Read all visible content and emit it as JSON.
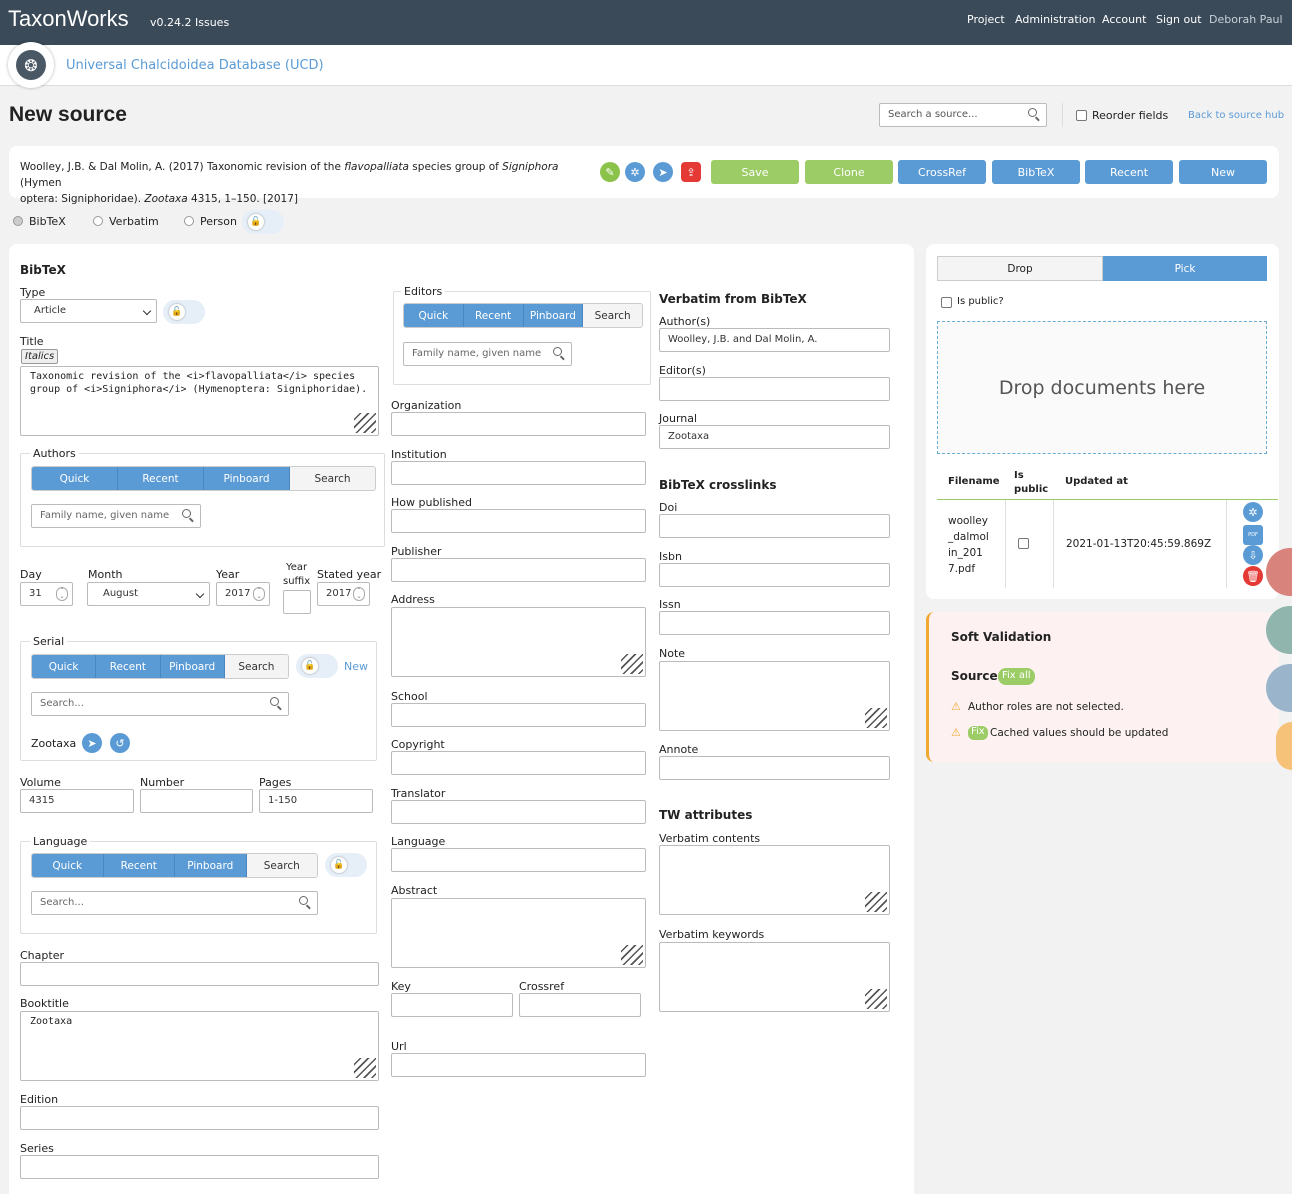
{
  "app": {
    "brand": "TaxonWorks",
    "version": "v0.24.2",
    "issues": "Issues",
    "project_name": "Universal Chalcidoidea Database (UCD)"
  },
  "nav": [
    "Project",
    "Administration",
    "Account",
    "Sign out",
    "Deborah Paul"
  ],
  "page": {
    "title": "New source",
    "search_placeholder": "Search a source...",
    "reorder_fields": "Reorder fields",
    "back_link": "Back to source hub"
  },
  "citation": {
    "part1": "Woolley, J.B. & Dal Molin, A. (2017) Taxonomic revision of the ",
    "italic1": "flavopalliata",
    "part2": " species group of ",
    "italic2": "Signiphora",
    "part3": " (Hymen",
    "line2_part1": "optera: Signiphoridae). ",
    "italic3": "Zootaxa",
    "line2_part2": " 4315, 1–150. [2017]"
  },
  "actions": [
    "Save",
    "Clone",
    "CrossRef",
    "BibTeX",
    "Recent",
    "New"
  ],
  "modes": {
    "bibtex": "BibTeX",
    "verbatim": "Verbatim",
    "person": "Person"
  },
  "bibtex": {
    "heading": "BibTeX",
    "type_label": "Type",
    "type_value": "Article",
    "title_label": "Title",
    "italics_btn": "Italics",
    "title_line1": "Taxonomic revision of the <i>flavopalliata</i> species",
    "title_line2": "group of <i>Signiphora</i> (Hymenoptera: Signiphoridae).",
    "authors_legend": "Authors",
    "tabs": [
      "Quick",
      "Recent",
      "Pinboard",
      "Search"
    ],
    "person_placeholder": "Family name, given name",
    "day_label": "Day",
    "day_value": "31",
    "month_label": "Month",
    "month_value": "August",
    "year_label": "Year",
    "year_value": "2017",
    "year_suffix_label1": "Year",
    "year_suffix_label2": "suffix",
    "stated_year_label": "Stated year",
    "stated_year_value": "2017",
    "serial_legend": "Serial",
    "serial_new": "New",
    "search_placeholder": "Search...",
    "serial_value": "Zootaxa",
    "volume_label": "Volume",
    "volume_value": "4315",
    "number_label": "Number",
    "pages_label": "Pages",
    "pages_value": "1-150",
    "language_legend": "Language",
    "chapter_label": "Chapter",
    "booktitle_label": "Booktitle",
    "booktitle_value": "Zootaxa",
    "edition_label": "Edition",
    "series_label": "Series"
  },
  "middle": {
    "editors_legend": "Editors",
    "organization": "Organization",
    "institution": "Institution",
    "how_published": "How published",
    "publisher": "Publisher",
    "address": "Address",
    "school": "School",
    "copyright": "Copyright",
    "translator": "Translator",
    "language": "Language",
    "abstract": "Abstract",
    "key": "Key",
    "crossref": "Crossref",
    "url": "Url"
  },
  "verbatim": {
    "heading": "Verbatim from BibTeX",
    "authors_label": "Author(s)",
    "authors_value": "Woolley, J.B. and Dal Molin, A.",
    "editors_label": "Editor(s)",
    "journal_label": "Journal",
    "journal_value": "Zootaxa",
    "crosslinks_heading": "BibTeX crosslinks",
    "doi": "Doi",
    "isbn": "Isbn",
    "issn": "Issn",
    "note": "Note",
    "annote": "Annote",
    "tw_heading": "TW attributes",
    "verbatim_contents": "Verbatim contents",
    "verbatim_keywords": "Verbatim keywords"
  },
  "documents": {
    "tab_drop": "Drop",
    "tab_pick": "Pick",
    "is_public": "Is public?",
    "drop_text": "Drop documents here",
    "col_filename": "Filename",
    "col_public1": "Is",
    "col_public2": "public",
    "col_updated": "Updated at",
    "file_l1": "woolley",
    "file_l2": "_dalmol",
    "file_l3": "in_201",
    "file_l4": "7.pdf",
    "updated": "2021-01-13T20:45:59.869Z",
    "pdf_badge": "PDF"
  },
  "soft_validation": {
    "heading": "Soft Validation",
    "source_label": "Source",
    "fix_all": "Fix all",
    "msg1": "Author roles are not selected.",
    "fix": "Fix",
    "msg2": "Cached values should be updated"
  },
  "colors": {
    "topbar": "#3a4a58",
    "accent": "#5b9bd5",
    "green": "#9ccc65",
    "warning": "#f0a830",
    "danger": "#e53935"
  }
}
